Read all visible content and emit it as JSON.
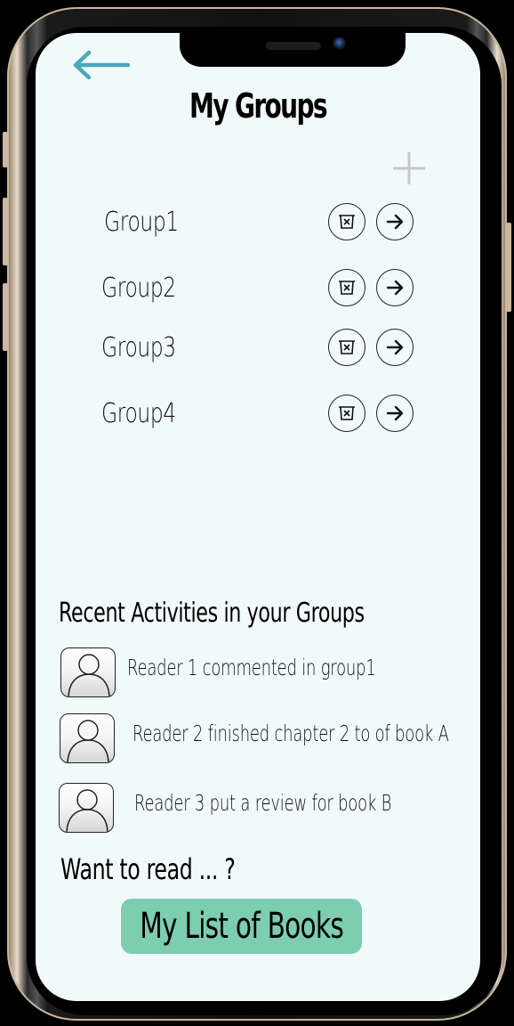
{
  "header": {
    "title": "My Groups",
    "back_icon": "arrow-left-icon",
    "add_icon": "plus-icon"
  },
  "groups": [
    {
      "name": "Group1",
      "delete_icon": "trash-x-icon",
      "open_icon": "arrow-right-icon"
    },
    {
      "name": "Group2",
      "delete_icon": "trash-x-icon",
      "open_icon": "arrow-right-icon"
    },
    {
      "name": "Group3",
      "delete_icon": "trash-x-icon",
      "open_icon": "arrow-right-icon"
    },
    {
      "name": "Group4",
      "delete_icon": "trash-x-icon",
      "open_icon": "arrow-right-icon"
    }
  ],
  "recent": {
    "title": "Recent Activities in your Groups",
    "items": [
      {
        "text": "Reader 1 commented in group1",
        "avatar_icon": "user-avatar-icon"
      },
      {
        "text": "Reader 2 finished chapter 2 to of book A",
        "avatar_icon": "user-avatar-icon"
      },
      {
        "text": "Reader 3 put a review for book B",
        "avatar_icon": "user-avatar-icon"
      }
    ]
  },
  "footer": {
    "prompt": "Want to read ... ?",
    "books_button_label": "My List of Books"
  },
  "colors": {
    "background": "#f1fafa",
    "back_arrow": "#4aa6bb",
    "add_icon": "#c8c8c8",
    "books_button": "#7dcdb0"
  }
}
